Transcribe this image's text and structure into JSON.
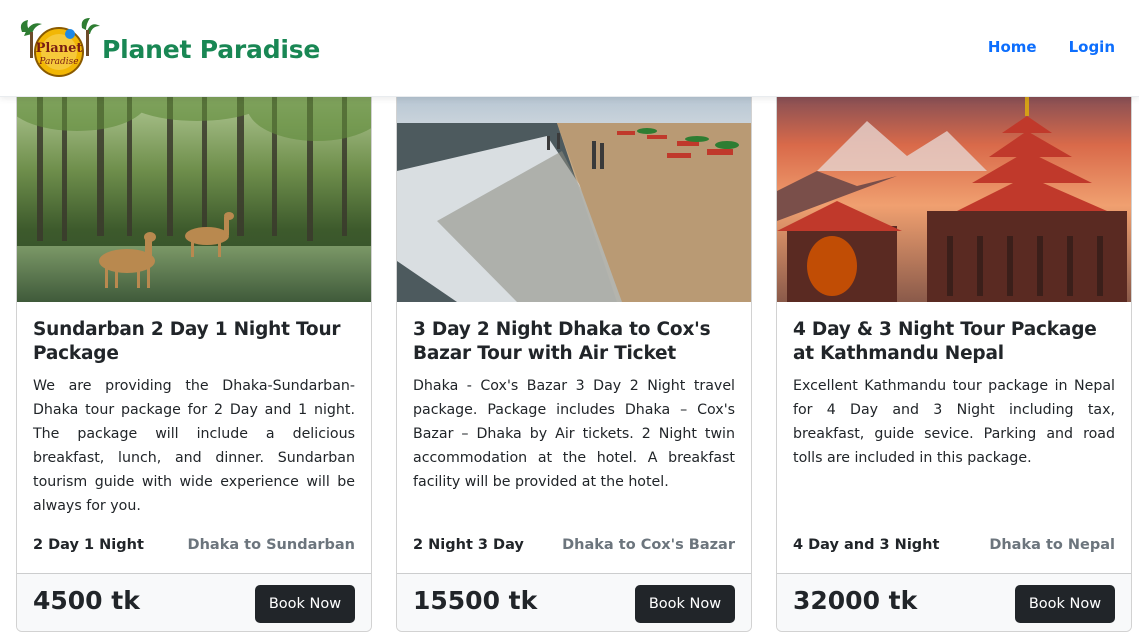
{
  "brand": {
    "name": "Planet Paradise",
    "logo_text_1": "Planet",
    "logo_text_2": "Paradise"
  },
  "nav": {
    "home": "Home",
    "login": "Login"
  },
  "colors": {
    "brand": "#198754",
    "link": "#0d6efd",
    "button": "#212529",
    "muted": "#6c757d"
  },
  "cards": [
    {
      "image": "sundarban-deer-forest-photo",
      "title": "Sundarban 2 Day 1 Night Tour Package",
      "description": "We are providing the Dhaka-Sundarban-Dhaka tour package for 2 Day and 1 night. The package will include a delicious breakfast, lunch, and dinner. Sundarban tourism guide with wide experience will be always for you.",
      "duration": "2 Day 1 Night",
      "route": "Dhaka to Sundarban",
      "price": "4500 tk",
      "button": "Book Now"
    },
    {
      "image": "coxs-bazar-beach-photo",
      "title": "3 Day 2 Night Dhaka to Cox's Bazar Tour with Air Ticket",
      "description": "Dhaka - Cox's Bazar 3 Day 2 Night travel package. Package includes Dhaka – Cox's Bazar – Dhaka by Air tickets. 2 Night twin accommodation at the hotel. A breakfast facility will be provided at the hotel.",
      "duration": "2 Night 3 Day",
      "route": "Dhaka to Cox's Bazar",
      "price": "15500 tk",
      "button": "Book Now"
    },
    {
      "image": "kathmandu-temple-photo",
      "title": "4 Day & 3 Night Tour Package at Kathmandu Nepal",
      "description": "Excellent Kathmandu tour package in Nepal for 4 Day and 3 Night including tax, breakfast, guide sevice. Parking and road tolls are included in this package.",
      "duration": "4 Day and 3 Night",
      "route": "Dhaka to Nepal",
      "price": "32000 tk",
      "button": "Book Now"
    }
  ]
}
